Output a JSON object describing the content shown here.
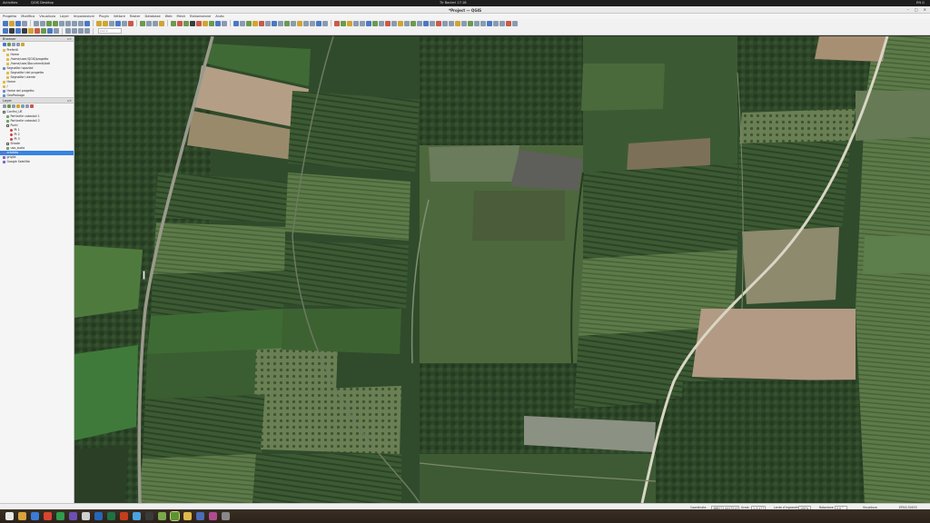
{
  "system_bar": {
    "activities": "Activities",
    "app": "QGIS Desktop",
    "clock": "Tir Bacleri 17:18",
    "sys": "EN  ⏻"
  },
  "window": {
    "title": "*Project — QGIS",
    "minimize": "–",
    "maximize": "□",
    "close": "✕"
  },
  "menu": [
    "Progetto",
    "Modifica",
    "Visualizza",
    "Layer",
    "Impostazioni",
    "Plugin",
    "Vettore",
    "Raster",
    "Database",
    "Web",
    "Mesh",
    "Elaborazione",
    "Aiuto"
  ],
  "toolbar": {
    "search_placeholder": "Cerca"
  },
  "browser_panel": {
    "title": "Browser",
    "controls": "▫✕",
    "items": [
      {
        "icon": "folder",
        "label": "Preferiti",
        "indent": 0
      },
      {
        "icon": "folder",
        "label": "Home",
        "indent": 1
      },
      {
        "icon": "folder",
        "label": "/home/user/QGIS/progetto",
        "indent": 1
      },
      {
        "icon": "folder",
        "label": "/home/user/Documenti/dati",
        "indent": 1
      },
      {
        "icon": "db",
        "label": "Segnalibri spaziali",
        "indent": 0
      },
      {
        "icon": "folder",
        "label": "Segnalibri del progetto",
        "indent": 1
      },
      {
        "icon": "folder",
        "label": "Segnalibri utente",
        "indent": 1
      },
      {
        "icon": "folder",
        "label": "Home",
        "indent": 0
      },
      {
        "icon": "folder",
        "label": "/",
        "indent": 0
      },
      {
        "icon": "db",
        "label": "Home del progetto",
        "indent": 0
      },
      {
        "icon": "db",
        "label": "GeoPackage",
        "indent": 0
      },
      {
        "icon": "db",
        "label": "SpatiaLite",
        "indent": 0
      }
    ]
  },
  "layers_panel": {
    "title": "Layer",
    "controls": "▫✕",
    "items": [
      {
        "icon": "chk",
        "label": "Confini_UE",
        "indent": 0,
        "selected": false
      },
      {
        "icon": "layer",
        "label": "Particelle catastali 1",
        "indent": 1,
        "selected": false
      },
      {
        "icon": "layer",
        "label": "Particelle catastali 2",
        "indent": 1,
        "selected": false
      },
      {
        "icon": "chk",
        "label": "Punti",
        "indent": 1,
        "selected": false
      },
      {
        "icon": "pt",
        "label": "Pt 1",
        "indent": 2,
        "selected": false
      },
      {
        "icon": "pt",
        "label": "Pt 2",
        "indent": 2,
        "selected": false
      },
      {
        "icon": "pt",
        "label": "Pt 3",
        "indent": 2,
        "selected": false
      },
      {
        "icon": "chk",
        "label": "Strade",
        "indent": 1,
        "selected": false
      },
      {
        "icon": "layer",
        "label": "uso_suolo",
        "indent": 1,
        "selected": false
      },
      {
        "icon": "raster",
        "label": "ortofoto",
        "indent": 0,
        "selected": true
      },
      {
        "icon": "raster",
        "label": "griglia",
        "indent": 0,
        "selected": false
      },
      {
        "icon": "raster",
        "label": "Google Satellite",
        "indent": 0,
        "selected": false
      }
    ]
  },
  "status": {
    "coord_label": "Coordinata",
    "coord_value": "488271,4417213",
    "scale_label": "Scala",
    "scale_value": "1:3.177",
    "magnifier_label": "Lente d'ingrandimento",
    "magnifier_value": "100%",
    "rotation_label": "Rotazione",
    "rotation_value": "0,0 °",
    "render_label": "Visualizza",
    "crs": "EPSG:32633"
  },
  "colors": {
    "accent": "#3584e4",
    "map_dark_green": "#2f4a2c",
    "map_mid_green": "#4f6a3f",
    "road": "#d8d6c4",
    "bare_soil": "#b49f86"
  }
}
